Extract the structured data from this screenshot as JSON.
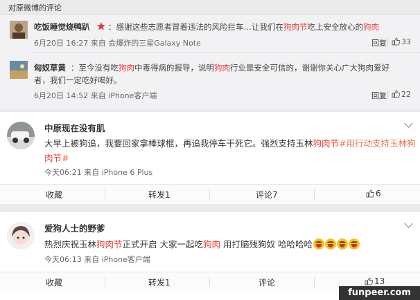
{
  "comments_section": {
    "header": "对原微博的评论",
    "comments": [
      {
        "author": "吃饭睡觉烧鸭趴",
        "text_parts": [
          "：感谢这些志愿者冒着违法的风险拦车…让我们在",
          "狗肉节",
          "吃上安全放心的",
          "狗肉"
        ],
        "time": "6月20日 16:27",
        "source": "来自 会爆炸的三星Galaxy Note",
        "reply": "回复",
        "likes": "33"
      },
      {
        "author": "匈奴草黄",
        "text_line1_parts": [
          "：至今没有吃",
          "狗肉",
          "中毒得病的报导，说明",
          "狗肉",
          "行业是安全可信的，谢谢你关心广大狗肉爱好"
        ],
        "text_line2": "者，我们一定吃好喝好。",
        "time": "6月20日 14:52",
        "source": "来自 iPhone客户端",
        "reply": "回复",
        "likes": "22"
      }
    ]
  },
  "posts": [
    {
      "author": "中原现在没有肌",
      "line1_parts": [
        "大早上被狗追，我要回家拿棒球棍，再追我停车干死它。强烈支持玉林",
        "狗肉节",
        "#用行动支持玉林狗"
      ],
      "line2_parts": [
        "肉节",
        "#"
      ],
      "time": "今天06:21",
      "source": "来自 iPhone 6 Plus",
      "actions": {
        "fav": "收藏",
        "repost": "转发1",
        "comment": "评论7",
        "like": "6"
      }
    },
    {
      "author": "爱狗人士的野爹",
      "line1_parts": [
        "热烈庆祝玉林",
        "狗肉节",
        "正式开启 大家一起吃",
        "狗肉",
        " 用打脑残狗奴 哈哈哈哈"
      ],
      "time": "今天06:13",
      "source": "来自 iPhone客户端",
      "actions": {
        "fav": "收藏",
        "repost": "转发1",
        "comment": "评论",
        "like": "13"
      }
    }
  ],
  "watermark": "funpeer.com",
  "colors": {
    "highlight": "#e8403a",
    "link": "#eb7350"
  }
}
